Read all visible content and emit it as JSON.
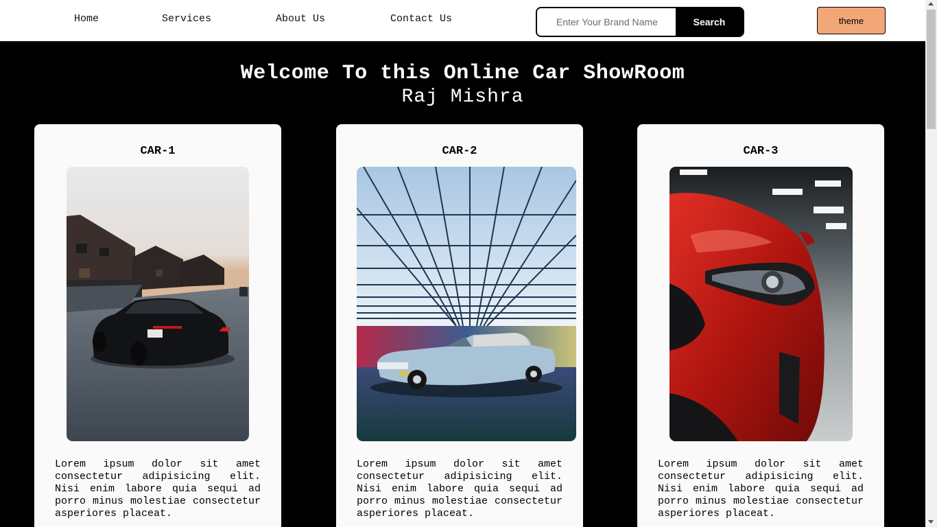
{
  "nav": {
    "links": [
      "Home",
      "Services",
      "About Us",
      "Contact Us"
    ]
  },
  "search": {
    "placeholder": "Enter Your Brand Name",
    "button_label": "Search"
  },
  "theme_button": {
    "label": "theme"
  },
  "hero": {
    "title": "Welcome To this Online Car ShowRoom",
    "subtitle": "Raj Mishra"
  },
  "cards": [
    {
      "title": "CAR-1",
      "image_icon": "black-sedan-photo",
      "description": "Lorem ipsum dolor sit amet consectetur adipisicing elit. Nisi enim labore quia sequi ad porro minus molestiae consectetur asperiores placeat."
    },
    {
      "title": "CAR-2",
      "image_icon": "vintage-convertible-photo",
      "description": "Lorem ipsum dolor sit amet consectetur adipisicing elit. Nisi enim labore quia sequi ad porro minus molestiae consectetur asperiores placeat."
    },
    {
      "title": "CAR-3",
      "image_icon": "red-sports-car-photo",
      "description": "Lorem ipsum dolor sit amet consectetur adipisicing elit. Nisi enim labore quia sequi ad porro minus molestiae consectetur asperiores placeat."
    }
  ],
  "colors": {
    "page_background": "#000000",
    "navbar_background": "#ffffff",
    "theme_button": "#f1a778",
    "card_background": "#fafafa"
  }
}
